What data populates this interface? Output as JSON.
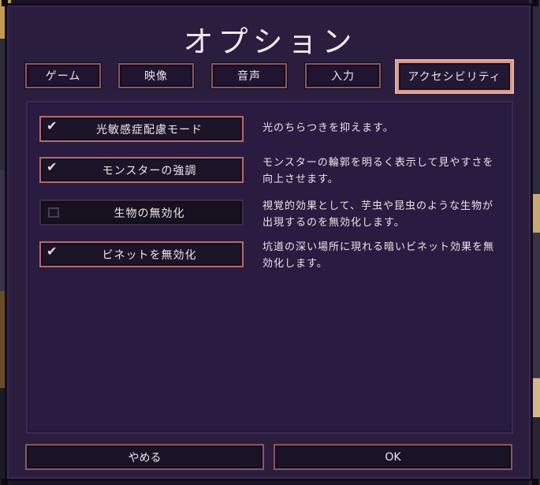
{
  "title": "オプション",
  "tabs": [
    {
      "label": "ゲーム",
      "active": false
    },
    {
      "label": "映像",
      "active": false
    },
    {
      "label": "音声",
      "active": false
    },
    {
      "label": "入力",
      "active": false
    },
    {
      "label": "アクセシビリティ",
      "active": true
    }
  ],
  "options": [
    {
      "label": "光敏感症配慮モード",
      "checked": true,
      "description": "光のちらつきを抑えます。"
    },
    {
      "label": "モンスターの強調",
      "checked": true,
      "description": "モンスターの輪郭を明るく表示して見やすさを向上させます。"
    },
    {
      "label": "生物の無効化",
      "checked": false,
      "description": "視覚的効果として、芋虫や昆虫のような生物が出現するのを無効化します。"
    },
    {
      "label": "ビネットを無効化",
      "checked": true,
      "description": "坑道の深い場所に現れる暗いビネット効果を無効化します。"
    }
  ],
  "buttons": {
    "cancel": "やめる",
    "ok": "OK"
  },
  "icons": {
    "checkmark": "✔"
  },
  "colors": {
    "panel_bg": "#2b1d3d",
    "active_tab_border": "#d79a8a",
    "button_border": "#b56a70",
    "text": "#f1e7ea"
  }
}
